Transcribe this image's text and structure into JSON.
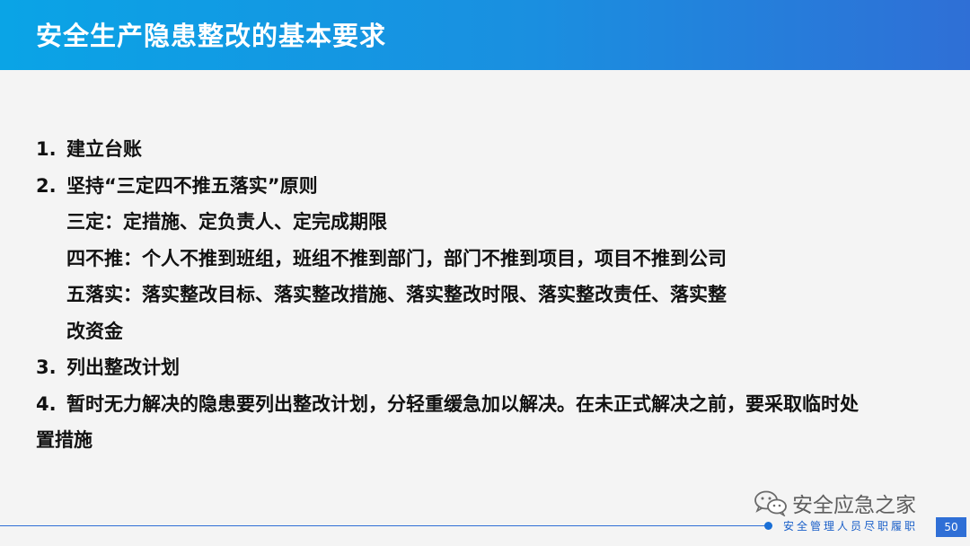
{
  "header": {
    "title": "安全生产隐患整改的基本要求"
  },
  "content": {
    "items": [
      {
        "num": "1.",
        "text": "建立台账"
      },
      {
        "num": "2.",
        "text": "坚持“三定四不推五落实”原则"
      },
      {
        "text": "三定：定措施、定负责人、定完成期限"
      },
      {
        "text": "四不推：个人不推到班组，班组不推到部门，部门不推到项目，项目不推到公司"
      },
      {
        "text": "五落实：落实整改目标、落实整改措施、落实整改时限、落实整改责任、落实整"
      },
      {
        "text": "改资金"
      },
      {
        "num": "3.",
        "text": "列出整改计划"
      },
      {
        "num": "4.",
        "text": "暂时无力解决的隐患要列出整改计划，分轻重缓急加以解决。在未正式解决之前，要采取临时处"
      },
      {
        "text": "置措施"
      }
    ]
  },
  "footer": {
    "text": "安全管理人员尽职履职",
    "page_number": "50"
  },
  "watermark": {
    "icon": "wechat-icon",
    "text": "安全应急之家"
  }
}
